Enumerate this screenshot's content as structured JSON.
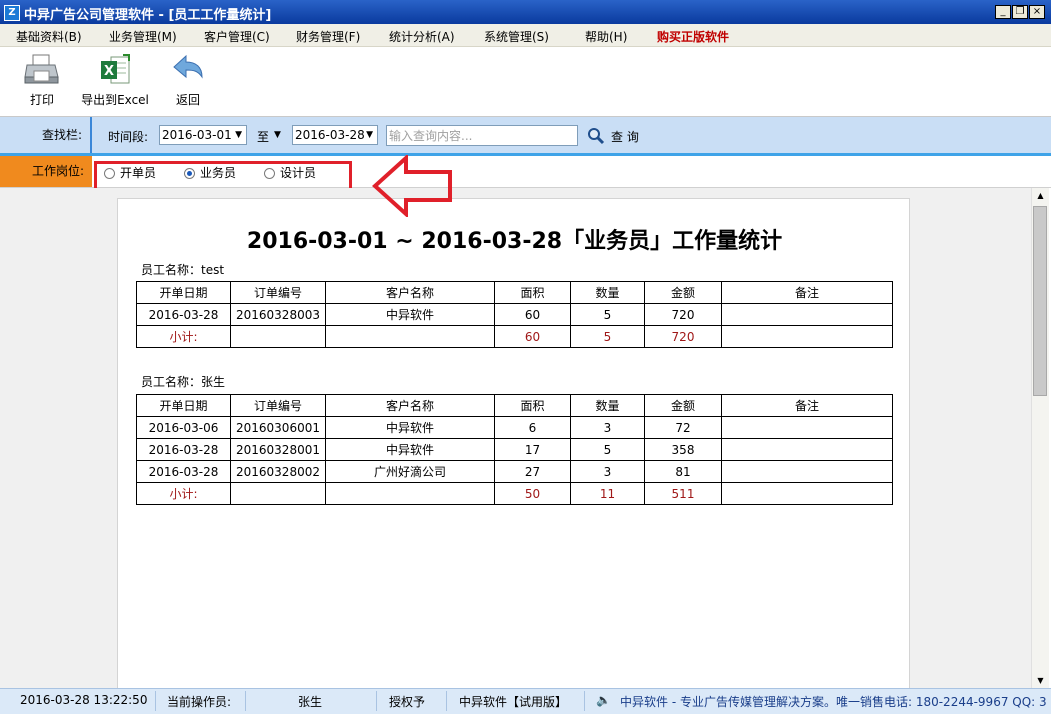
{
  "window": {
    "title": "中异广告公司管理软件 - [员工工作量统计]",
    "app_icon_glyph": "Z",
    "min_glyph": "_",
    "restore_glyph": "❐",
    "close_glyph": "×"
  },
  "menu": {
    "items": [
      {
        "label": "基础资料(B)"
      },
      {
        "label": "业务管理(M)"
      },
      {
        "label": "客户管理(C)"
      },
      {
        "label": "财务管理(F)"
      },
      {
        "label": "统计分析(A)"
      },
      {
        "label": "系统管理(S)"
      },
      {
        "label": "帮助(H)"
      },
      {
        "label": "购买正版软件"
      }
    ],
    "buy_color": "#c00000"
  },
  "toolbar": {
    "print": {
      "label": "打印",
      "icon": "printer-icon"
    },
    "export": {
      "label": "导出到Excel",
      "icon": "excel-icon"
    },
    "back": {
      "label": "返回",
      "icon": "back-arrow-icon"
    }
  },
  "search": {
    "bar_label": "查找栏:",
    "period_label": "时间段:",
    "date_from": "2016-03-01",
    "to_label": "至",
    "date_to": "2016-03-28",
    "placeholder": "输入查询内容...",
    "button_label": "查 询"
  },
  "position": {
    "label": "工作岗位:",
    "options": [
      {
        "label": "开单员",
        "selected": false
      },
      {
        "label": "业务员",
        "selected": true
      },
      {
        "label": "设计员",
        "selected": false
      }
    ],
    "highlight_color": "#e0202a"
  },
  "report": {
    "title": "2016-03-01 ~ 2016-03-28「业务员」工作量统计",
    "columns": [
      "开单日期",
      "订单编号",
      "客户名称",
      "面积",
      "数量",
      "金额",
      "备注"
    ],
    "groups": [
      {
        "employee_label": "员工名称：test",
        "rows": [
          [
            "2016-03-28",
            "20160328003",
            "中异软件",
            "60",
            "5",
            "720",
            ""
          ]
        ],
        "subtotal": [
          "小计:",
          "",
          "",
          "60",
          "5",
          "720",
          ""
        ]
      },
      {
        "employee_label": "员工名称：张生",
        "rows": [
          [
            "2016-03-06",
            "20160306001",
            "中异软件",
            "6",
            "3",
            "72",
            ""
          ],
          [
            "2016-03-28",
            "20160328001",
            "中异软件",
            "17",
            "5",
            "358",
            ""
          ],
          [
            "2016-03-28",
            "20160328002",
            "广州好滴公司",
            "27",
            "3",
            "81",
            ""
          ]
        ],
        "subtotal": [
          "小计:",
          "",
          "",
          "50",
          "11",
          "511",
          ""
        ]
      }
    ]
  },
  "status": {
    "datetime": "2016-03-28 13:22:50",
    "operator_label": "当前操作员:",
    "operator": "张生",
    "auth_label": "授权予",
    "edition": "中异软件【试用版】",
    "marquee": "中异软件 - 专业广告传媒管理解决方案。唯一销售电话: 180-2244-9967 QQ: 3"
  }
}
